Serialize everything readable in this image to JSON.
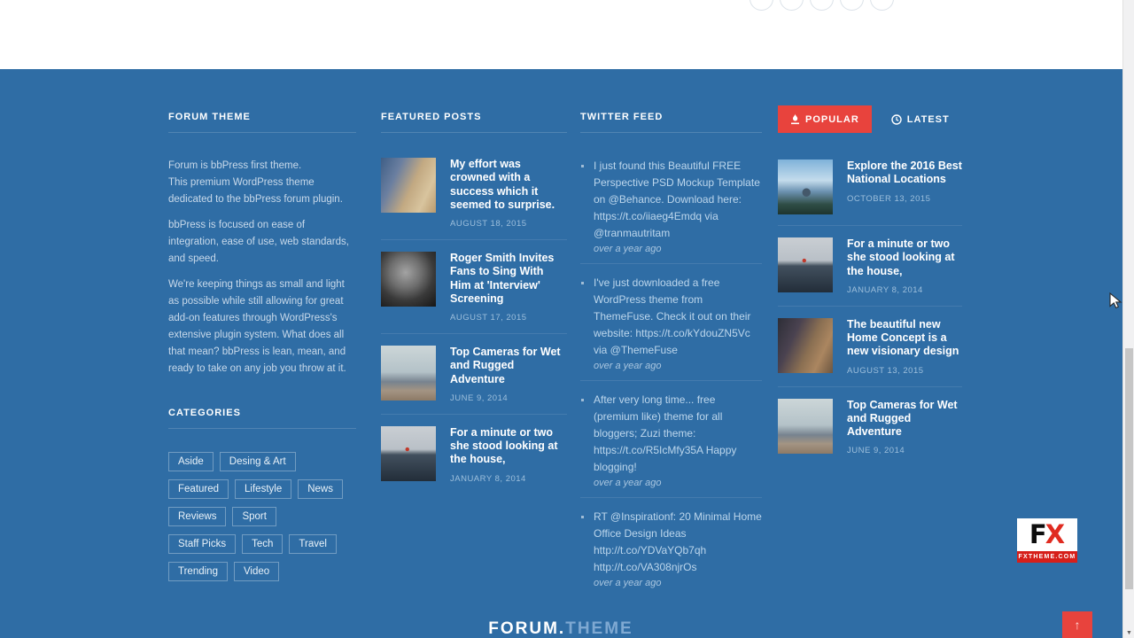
{
  "colors": {
    "footer_bg": "#2f6da5",
    "accent_red": "#e8433d",
    "text_light": "#c8d9ea",
    "muted": "#9dbfdc",
    "logo_theme": "#7fa9d2"
  },
  "widgets": {
    "about": {
      "title": "FORUM THEME",
      "paragraphs": [
        "Forum is bbPress first theme.\nThis premium WordPress theme dedicated to the bbPress forum plugin.",
        "bbPress is focused on ease of integration, ease of use, web standards, and speed.",
        "We're keeping things as small and light as possible while still allowing for great add-on features through WordPress's extensive plugin system. What does all that mean? bbPress is lean, mean, and ready to take on any job you throw at it."
      ]
    },
    "categories": {
      "title": "CATEGORIES",
      "tags": [
        "Aside",
        "Desing & Art",
        "Featured",
        "Lifestyle",
        "News",
        "Reviews",
        "Sport",
        "Staff Picks",
        "Tech",
        "Travel",
        "Trending",
        "Video"
      ]
    },
    "featured": {
      "title": "FEATURED POSTS",
      "posts": [
        {
          "title": "My effort was crowned with a success which it seemed to surprise.",
          "date": "AUGUST 18, 2015",
          "thumb": "dog-walk"
        },
        {
          "title": "Roger Smith Invites Fans to Sing With Him at 'Interview' Screening",
          "date": "AUGUST 17, 2015",
          "thumb": "portrait"
        },
        {
          "title": "Top Cameras for Wet and Rugged Adventure",
          "date": "JUNE 9, 2014",
          "thumb": "camera"
        },
        {
          "title": "For a minute or two she stood looking at the house,",
          "date": "JANUARY 8, 2014",
          "thumb": "beach"
        }
      ]
    },
    "twitter": {
      "title": "TWITTER FEED",
      "tweets": [
        {
          "text": "I just found this Beautiful FREE Perspective PSD Mockup Template on @Behance. Download here: https://t.co/iiaeg4Emdq via @tranmautritam",
          "time": "over a year ago"
        },
        {
          "text": "I've just downloaded a free WordPress theme from ThemeFuse. Check it out on their website: https://t.co/kYdouZN5Vc via @ThemeFuse",
          "time": "over a year ago"
        },
        {
          "text": "After very long time... free (premium like) theme for all bloggers; Zuzi theme: https://t.co/R5IcMfy35A Happy blogging!",
          "time": "over a year ago"
        },
        {
          "text": "RT @Inspirationf: 20 Minimal Home Office Design Ideas http://t.co/YDVaYQb7qh http://t.co/VA308njrOs",
          "time": "over a year ago"
        }
      ]
    },
    "tabs": {
      "popular_label": "POPULAR",
      "popular_icon": "flame-icon",
      "latest_label": "LATEST",
      "latest_icon": "clock-icon",
      "posts": [
        {
          "title": "Explore the 2016 Best National Locations",
          "date": "OCTOBER 13, 2015",
          "thumb": "mountain"
        },
        {
          "title": "For a minute or two she stood looking at the house,",
          "date": "JANUARY 8, 2014",
          "thumb": "beach"
        },
        {
          "title": "The beautiful new Home Concept is a new visionary design",
          "date": "AUGUST 13, 2015",
          "thumb": "office"
        },
        {
          "title": "Top Cameras for Wet and Rugged Adventure",
          "date": "JUNE 9, 2014",
          "thumb": "camera"
        }
      ]
    }
  },
  "footer_logo": {
    "primary": "FORUM.",
    "secondary": "THEME"
  },
  "fx_logo": {
    "f": "F",
    "x": "X",
    "site": "FXTHEME.COM"
  },
  "scroll_top": {
    "icon": "arrow-up-icon",
    "glyph": "↑"
  },
  "scrollbar": {
    "down_arrow": "▼"
  }
}
